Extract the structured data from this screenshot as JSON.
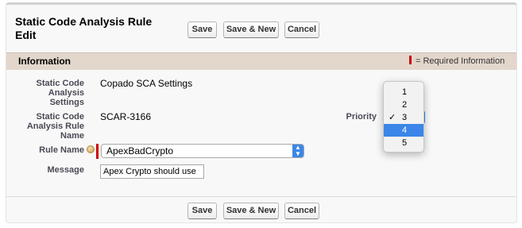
{
  "page": {
    "title": "Static Code Analysis Rule Edit"
  },
  "toolbar_top": {
    "save_label": "Save",
    "save_new_label": "Save & New",
    "cancel_label": "Cancel"
  },
  "toolbar_bottom": {
    "save_label": "Save",
    "save_new_label": "Save & New",
    "cancel_label": "Cancel"
  },
  "section": {
    "title": "Information",
    "required_legend": "= Required Information"
  },
  "fields": {
    "settings": {
      "label": "Static Code Analysis Settings",
      "value": "Copado SCA Settings"
    },
    "rule_name_record": {
      "label": "Static Code Analysis Rule Name",
      "value": "SCAR-3166"
    },
    "rule_name": {
      "label": "Rule Name",
      "selected": "ApexBadCrypto"
    },
    "message": {
      "label": "Message",
      "value": "Apex Crypto should use"
    },
    "priority": {
      "label": "Priority",
      "selected": "3",
      "highlighted": "4",
      "options": [
        "1",
        "2",
        "3",
        "4",
        "5"
      ]
    }
  },
  "icons": {
    "help": "help-icon",
    "check": "checkmark-icon",
    "select_arrows": "up-down-chevron-icon"
  },
  "colors": {
    "header_band": "#e3d7cc",
    "required": "#cc0000",
    "accent": "#3b86e8"
  }
}
